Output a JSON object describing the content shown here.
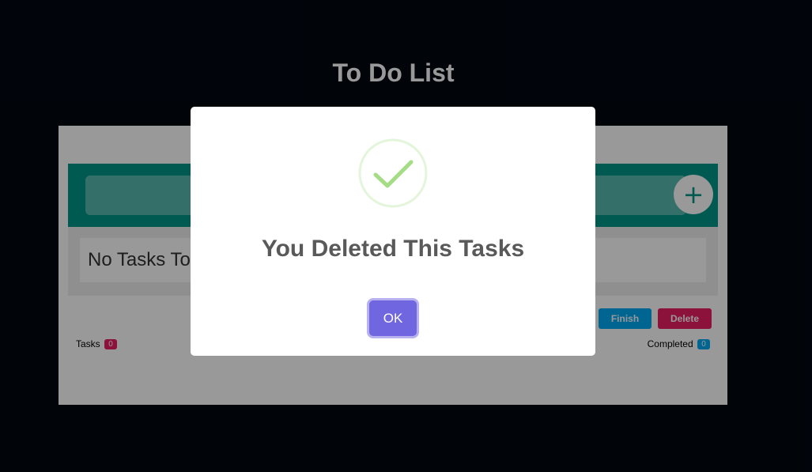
{
  "page": {
    "title": "To Do List"
  },
  "input": {
    "placeholder": "",
    "value": ""
  },
  "add_button": {
    "label": "+"
  },
  "empty_message": "No Tasks To Show",
  "actions": {
    "finish_label": "Finish",
    "delete_label": "Delete"
  },
  "stats": {
    "tasks_label": "Tasks",
    "tasks_count": "0",
    "completed_label": "Completed",
    "completed_count": "0"
  },
  "modal": {
    "icon": "success-check-icon",
    "title": "You Deleted This Tasks",
    "confirm_label": "OK"
  },
  "colors": {
    "accent": "#009688",
    "finish": "#03a9f4",
    "delete": "#e91e63",
    "confirm": "#7066e0"
  }
}
